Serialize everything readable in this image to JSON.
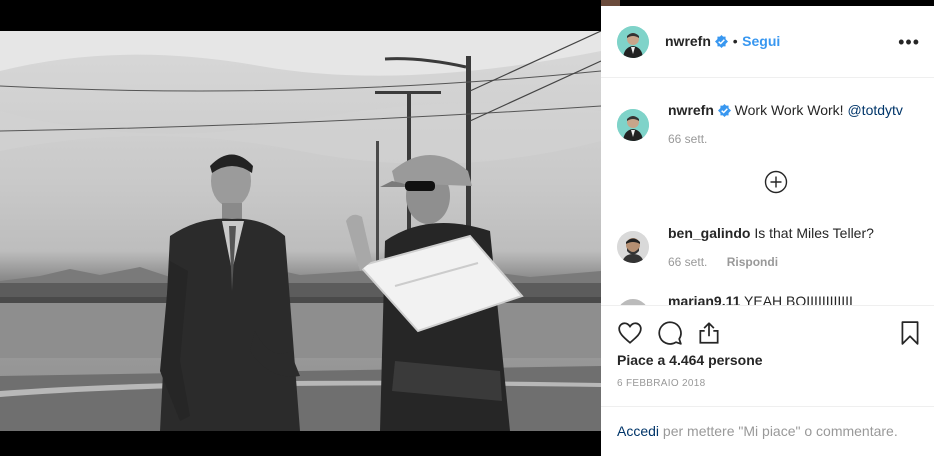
{
  "post": {
    "author": "nwrefn",
    "follow_label": "Segui",
    "separator": "•",
    "more_glyph": "•••"
  },
  "caption": {
    "author": "nwrefn",
    "text": "Work Work Work!",
    "mention": "@totdytv",
    "time": "66 sett."
  },
  "comments": [
    {
      "author": "ben_galindo",
      "text": "Is that Miles Teller?",
      "time": "66 sett.",
      "reply_label": "Rispondi"
    },
    {
      "author": "marian9.11",
      "text": "YEAH BOIIIIIIIIIIII",
      "time": "",
      "reply_label": ""
    }
  ],
  "likes_text": "Piace a 4.464 persone",
  "date_text": "6 FEBBRAIO 2018",
  "login": {
    "link": "Accedi",
    "rest": "per mettere \"Mi piace\" o commentare."
  },
  "icons": [
    "heart-icon",
    "comment-icon",
    "share-icon",
    "bookmark-icon",
    "verified-icon",
    "add-circle-icon",
    "more-icon"
  ],
  "colors": {
    "accent": "#3897f0",
    "verified": "#3897f0",
    "link": "#003569",
    "muted": "#999999",
    "avatar_bg": "#7fd3c9"
  }
}
